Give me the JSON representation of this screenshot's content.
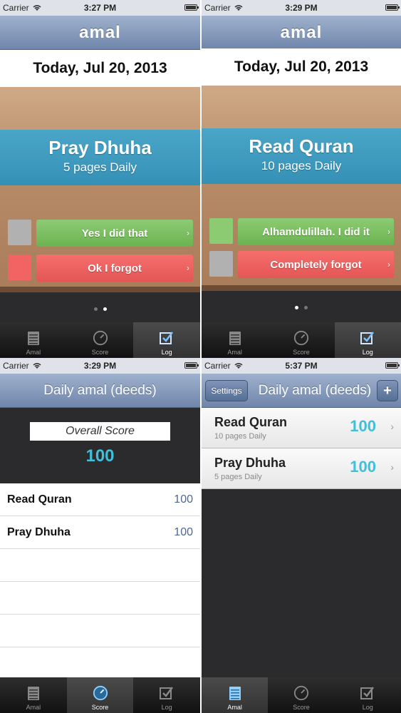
{
  "statusbars": [
    {
      "carrier": "Carrier",
      "time": "3:27 PM"
    },
    {
      "carrier": "Carrier",
      "time": "3:29 PM"
    },
    {
      "carrier": "Carrier",
      "time": "3:29 PM"
    },
    {
      "carrier": "Carrier",
      "time": "5:37 PM"
    }
  ],
  "app_logo": "amal",
  "date": "Today, Jul 20, 2013",
  "screen1": {
    "deed_title": "Pray Dhuha",
    "deed_sub": "5 pages Daily",
    "yes_label": "Yes I did that",
    "no_label": "Ok I forgot"
  },
  "screen2": {
    "deed_title": "Read Quran",
    "deed_sub": "10 pages Daily",
    "yes_label": "Alhamdulillah. I did it",
    "no_label": "Completely forgot"
  },
  "screen3": {
    "title": "Daily amal (deeds)",
    "overall_label": "Overall Score",
    "overall_value": "100",
    "rows": [
      {
        "name": "Read Quran",
        "score": "100"
      },
      {
        "name": "Pray Dhuha",
        "score": "100"
      }
    ]
  },
  "screen4": {
    "title": "Daily amal (deeds)",
    "settings_label": "Settings",
    "add_label": "+",
    "rows": [
      {
        "name": "Read Quran",
        "sub": "10 pages Daily",
        "score": "100"
      },
      {
        "name": "Pray Dhuha",
        "sub": "5 pages Daily",
        "score": "100"
      }
    ]
  },
  "tabs": [
    "Amal",
    "Score",
    "Log"
  ],
  "colors": {
    "accent": "#3fc0d8",
    "green": "#6cb351",
    "red": "#e35655",
    "navbar": "#6f86ab"
  }
}
